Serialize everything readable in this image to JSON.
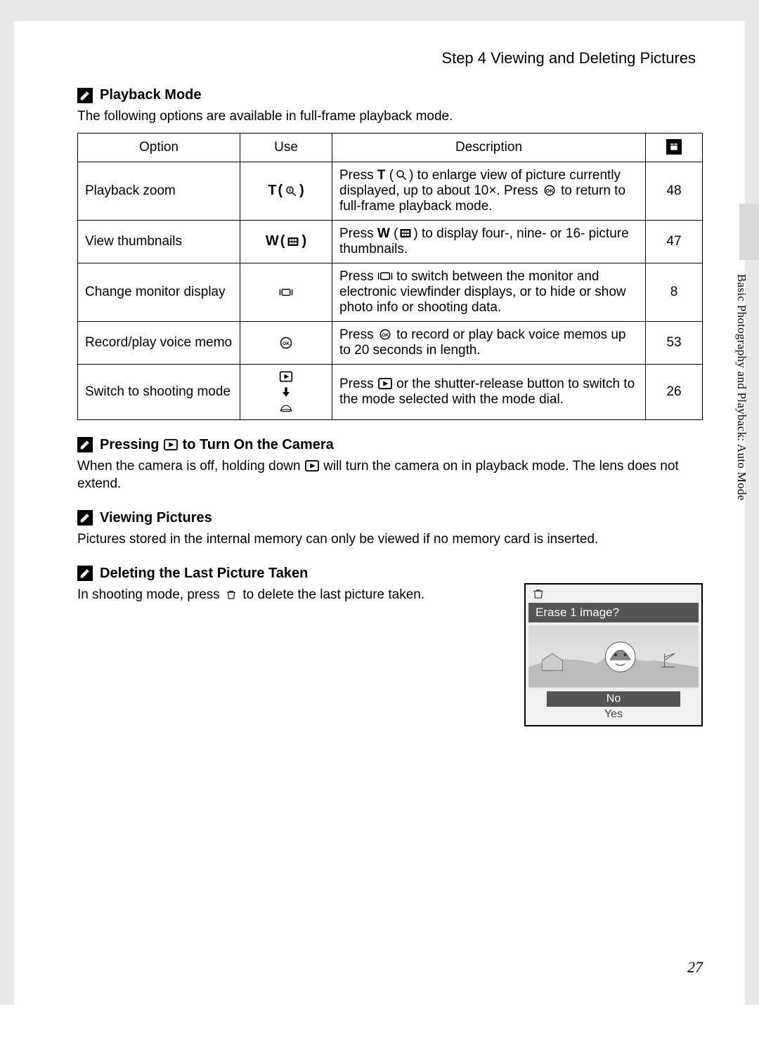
{
  "step_title": "Step 4 Viewing and Deleting Pictures",
  "side_text": "Basic Photography and Playback: Auto Mode",
  "page_number": "27",
  "sections": {
    "playback_mode": {
      "heading": "Playback Mode",
      "intro": "The following options are available in full-frame playback mode."
    },
    "pressing_play": {
      "heading_pre": "Pressing ",
      "heading_post": " to Turn On the Camera",
      "body_pre": "When the camera is off, holding down ",
      "body_post": " will turn the camera on in playback mode. The lens does not extend."
    },
    "viewing_pictures": {
      "heading": "Viewing Pictures",
      "body": "Pictures stored in the internal memory can only be viewed if no memory card is inserted."
    },
    "deleting_last": {
      "heading": "Deleting the Last Picture Taken",
      "body_pre": "In shooting mode, press ",
      "body_post": " to delete the last picture taken."
    }
  },
  "table": {
    "headers": {
      "option": "Option",
      "use": "Use",
      "description": "Description"
    },
    "rows": [
      {
        "option": "Playback zoom",
        "use_label": "T",
        "desc_a": "Press ",
        "desc_b": " to enlarge view of picture currently displayed, up to about 10×. Press ",
        "desc_c": " to return to full-frame playback mode.",
        "page": "48"
      },
      {
        "option": "View thumbnails",
        "use_label": "W",
        "desc_a": "Press ",
        "desc_b": " to display four-, nine- or 16- picture thumbnails.",
        "page": "47"
      },
      {
        "option": "Change monitor display",
        "desc_a": "Press ",
        "desc_b": " to switch between the monitor and electronic viewfinder displays, or to hide or show photo info or shooting data.",
        "page": "8"
      },
      {
        "option": "Record/play voice memo",
        "desc_a": "Press ",
        "desc_b": " to record or play back voice memos up to 20 seconds in length.",
        "page": "53"
      },
      {
        "option": "Switch to shooting mode",
        "desc_a": "Press ",
        "desc_b": " or the shutter-release button to switch to the mode selected with the mode dial.",
        "page": "26"
      }
    ]
  },
  "erase_dialog": {
    "title": "Erase 1 image?",
    "option_no": "No",
    "option_yes": "Yes"
  }
}
